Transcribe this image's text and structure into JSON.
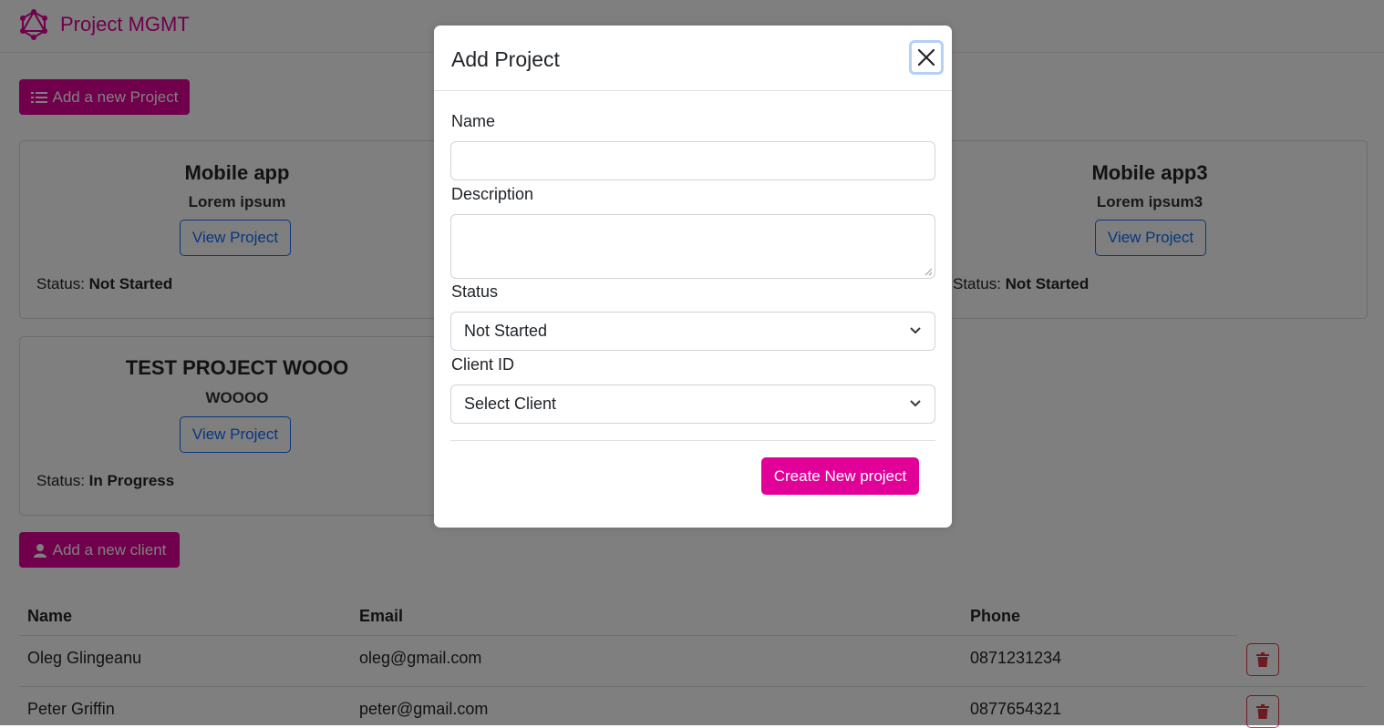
{
  "app": {
    "brand": "Project MGMT"
  },
  "actions": {
    "add_project": "Add a new Project",
    "add_client": "Add a new client"
  },
  "projects": [
    {
      "name": "Mobile app",
      "description": "Lorem ipsum",
      "button": "View Project",
      "status_label": "Status:",
      "status": "Not Started"
    },
    {
      "name": "Mobile app3",
      "description": "Lorem ipsum3",
      "button": "View Project",
      "status_label": "Status:",
      "status": "Not Started"
    },
    {
      "name": "TEST PROJECT WOOO",
      "description": "WOOOO",
      "button": "View Project",
      "status_label": "Status:",
      "status": "In Progress"
    }
  ],
  "clients": {
    "headers": [
      "Name",
      "Email",
      "Phone"
    ],
    "rows": [
      {
        "name": "Oleg Glingeanu",
        "email": "oleg@gmail.com",
        "phone": "0871231234"
      },
      {
        "name": "Peter Griffin",
        "email": "peter@gmail.com",
        "phone": "0877654321"
      }
    ]
  },
  "modal": {
    "title": "Add Project",
    "name_label": "Name",
    "name_value": "",
    "description_label": "Description",
    "description_value": "",
    "status_label": "Status",
    "status_value": "Not Started",
    "client_label": "Client ID",
    "client_value": "Select Client",
    "submit": "Create New project"
  },
  "colors": {
    "brand": "#e10098",
    "primary": "#0d6efd",
    "danger": "#dc3545"
  },
  "icons": [
    "graphql-logo-icon",
    "list-icon",
    "user-icon",
    "close-icon",
    "chevron-down-icon",
    "trash-icon"
  ]
}
